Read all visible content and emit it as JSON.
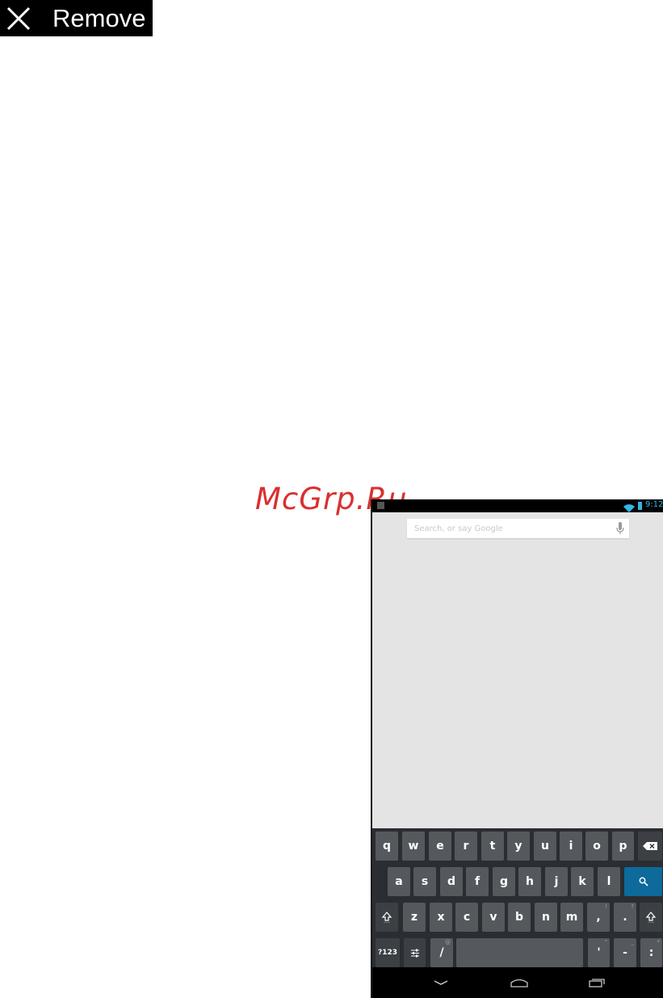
{
  "remove_bar": {
    "label": "Remove",
    "icon": "close-icon"
  },
  "watermark": {
    "text": "McGrp.Ru"
  },
  "status_bar": {
    "time": "9:12",
    "accent": "#33b5e5"
  },
  "search": {
    "placeholder": "Search, or say Google"
  },
  "keyboard": {
    "row1": [
      "q",
      "w",
      "e",
      "r",
      "t",
      "y",
      "u",
      "i",
      "o",
      "p"
    ],
    "row2": [
      "a",
      "s",
      "d",
      "f",
      "g",
      "h",
      "j",
      "k",
      "l"
    ],
    "row3": [
      "z",
      "x",
      "c",
      "v",
      "b",
      "n",
      "m",
      ",",
      "."
    ],
    "row3_hints": [
      "!",
      "?"
    ],
    "row4": {
      "symbols": "?123",
      "slash": "/",
      "slash_hint": "@",
      "apostrophe": "'",
      "apostrophe_hint": "\"",
      "dash": "-",
      "dash_hint": "_",
      "colon": ":",
      "colon_hint": "*"
    }
  },
  "colors": {
    "remove_bg": "#000000",
    "watermark": "#d9302e",
    "keyboard_bg": "#2a2d32",
    "key": "#55595e",
    "search_key": "#0d6a9a"
  }
}
